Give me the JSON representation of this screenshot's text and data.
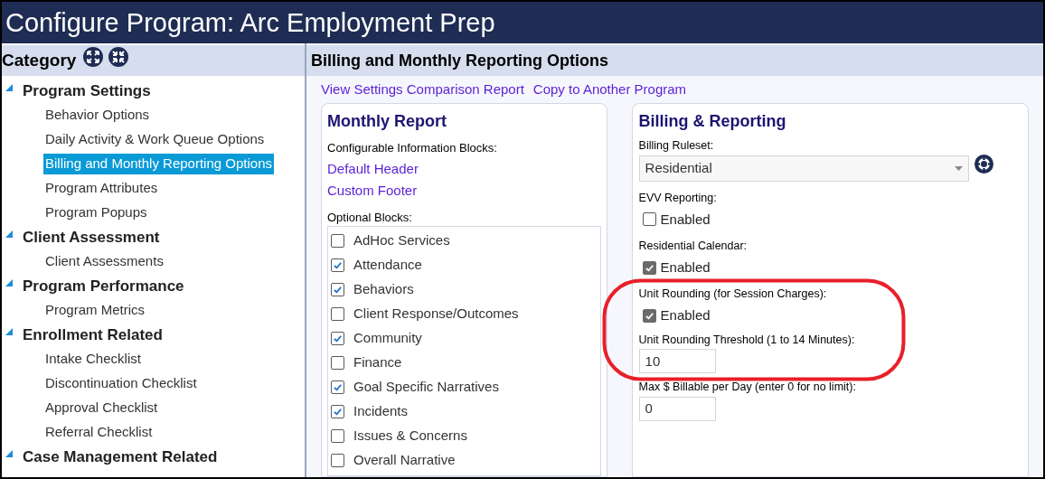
{
  "window": {
    "title": "Configure Program: Arc Employment Prep"
  },
  "sidebar": {
    "title": "Category",
    "groups": [
      {
        "label": "Program Settings",
        "expanded": true,
        "children": [
          {
            "label": "Behavior Options",
            "selected": false
          },
          {
            "label": "Daily Activity & Work Queue Options",
            "selected": false
          },
          {
            "label": "Billing and Monthly Reporting Options",
            "selected": true
          },
          {
            "label": "Program Attributes",
            "selected": false
          },
          {
            "label": "Program Popups",
            "selected": false
          }
        ]
      },
      {
        "label": "Client Assessment",
        "expanded": true,
        "children": [
          {
            "label": "Client Assessments",
            "selected": false
          }
        ]
      },
      {
        "label": "Program Performance",
        "expanded": true,
        "children": [
          {
            "label": "Program Metrics",
            "selected": false
          }
        ]
      },
      {
        "label": "Enrollment Related",
        "expanded": true,
        "children": [
          {
            "label": "Intake Checklist",
            "selected": false
          },
          {
            "label": "Discontinuation Checklist",
            "selected": false
          },
          {
            "label": "Approval Checklist",
            "selected": false
          },
          {
            "label": "Referral Checklist",
            "selected": false
          }
        ]
      },
      {
        "label": "Case Management Related",
        "expanded": true
      }
    ]
  },
  "main": {
    "title": "Billing and Monthly Reporting Options",
    "links": [
      "View Settings Comparison Report",
      "Copy to Another Program"
    ],
    "monthly_report": {
      "title": "Monthly Report",
      "info_label": "Configurable Information Blocks:",
      "info_links": [
        "Default Header",
        "Custom Footer"
      ],
      "optional_label": "Optional Blocks:",
      "blocks": [
        {
          "label": "AdHoc Services",
          "checked": false
        },
        {
          "label": "Attendance",
          "checked": true
        },
        {
          "label": "Behaviors",
          "checked": true
        },
        {
          "label": "Client Response/Outcomes",
          "checked": false
        },
        {
          "label": "Community",
          "checked": true
        },
        {
          "label": "Finance",
          "checked": false
        },
        {
          "label": "Goal Specific Narratives",
          "checked": true
        },
        {
          "label": "Incidents",
          "checked": true
        },
        {
          "label": "Issues & Concerns",
          "checked": false
        },
        {
          "label": "Overall Narrative",
          "checked": false
        }
      ]
    },
    "billing": {
      "title": "Billing & Reporting",
      "fields": [
        {
          "kind": "select",
          "label": "Billing Ruleset:",
          "value": "Residential"
        },
        {
          "kind": "checkbox",
          "label": "EVV Reporting:",
          "option": "Enabled",
          "checked": false
        },
        {
          "kind": "checkbox",
          "label": "Residential Calendar:",
          "option": "Enabled",
          "checked": true
        },
        {
          "kind": "checkbox",
          "label": "Unit Rounding (for Session Charges):",
          "option": "Enabled",
          "checked": true
        },
        {
          "kind": "text",
          "label": "Unit Rounding Threshold (1 to 14 Minutes):",
          "value": "10"
        },
        {
          "kind": "text",
          "label": "Max $ Billable per Day (enter 0 for no limit):",
          "value": "0"
        }
      ]
    }
  }
}
